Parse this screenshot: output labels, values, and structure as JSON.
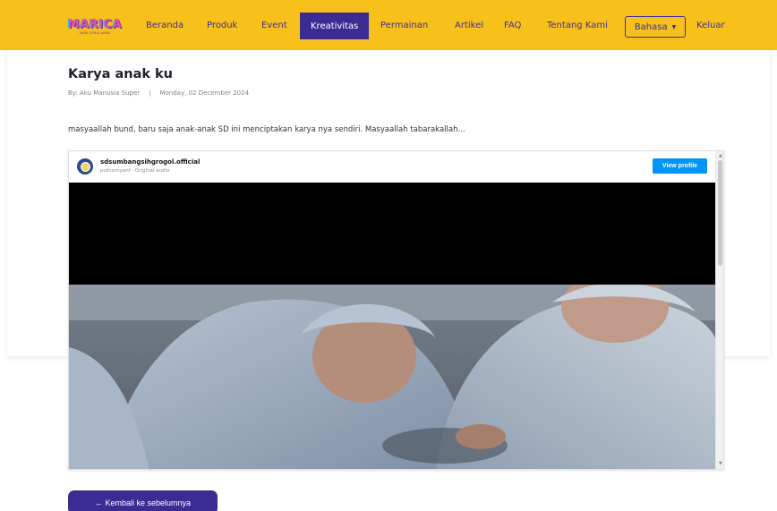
{
  "brand": {
    "logo_text": "MARICA",
    "logo_tagline": "MARI CERIA ANAK",
    "colors": {
      "navbar": "#f8c01a",
      "accent": "#3b2c94",
      "button_blue": "#0095f6"
    }
  },
  "nav": {
    "items": [
      {
        "label": "Beranda"
      },
      {
        "label": "Produk"
      },
      {
        "label": "Event"
      },
      {
        "label": "Kreativitas",
        "active": true
      },
      {
        "label": "Permainan"
      },
      {
        "label": "Artikel"
      },
      {
        "label": "FAQ"
      },
      {
        "label": "Tentang Kami"
      }
    ],
    "language_label": "Bahasa",
    "logout_label": "Keluar"
  },
  "post": {
    "title": "Karya anak ku",
    "author": "By: Aku Manusia Super",
    "separator": "|",
    "date": "Monday, 02 December 2024",
    "body": "masyaallah bund, baru saja anak-anak SD ini menciptakan karya nya sendiri. Masyaallah tabarakallah..."
  },
  "embed": {
    "username": "sdsumbangsihgrogol.official",
    "subtitle": "puthornyanf · Original audio",
    "view_profile_label": "View profile",
    "avatar_icon": "school-logo-icon"
  },
  "back_button": {
    "label": "← Kembali ke sebelumnya"
  }
}
